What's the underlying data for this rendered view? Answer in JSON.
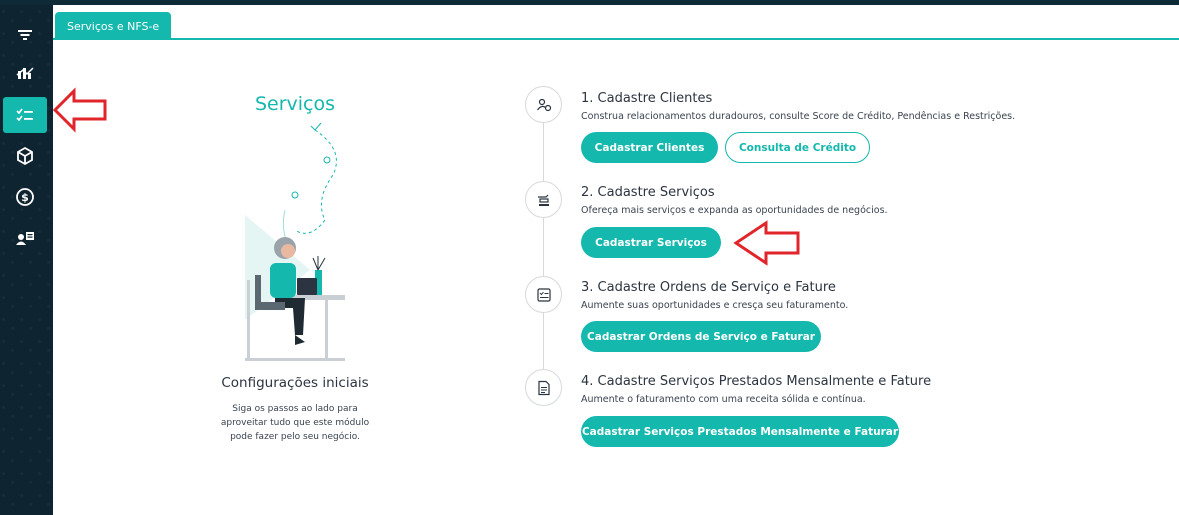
{
  "tab": {
    "label": "Serviços e NFS-e"
  },
  "sidebar": {
    "items": [
      {
        "icon": "filter-icon"
      },
      {
        "icon": "chart-icon"
      },
      {
        "icon": "checklist-icon",
        "active": true
      },
      {
        "icon": "box-icon"
      },
      {
        "icon": "dollar-icon"
      },
      {
        "icon": "user-card-icon"
      }
    ]
  },
  "left": {
    "title": "Serviços",
    "config_title": "Configurações iniciais",
    "config_desc": "Siga os passos ao lado para aproveitar tudo que este módulo pode fazer pelo seu negócio."
  },
  "steps": [
    {
      "title": "1. Cadastre Clientes",
      "desc": "Construa relacionamentos duradouros, consulte Score de Crédito, Pendências e Restrições.",
      "icon": "users-gear-icon",
      "buttons": [
        "Cadastrar Clientes",
        "Consulta de Crédito"
      ]
    },
    {
      "title": "2. Cadastre Serviços",
      "desc": "Ofereça mais serviços e expanda as oportunidades de negócios.",
      "icon": "service-hand-icon",
      "buttons": [
        "Cadastrar Serviços"
      ]
    },
    {
      "title": "3. Cadastre Ordens de Serviço e Fature",
      "desc": "Aumente suas oportunidades e cresça seu faturamento.",
      "icon": "checklist-board-icon",
      "buttons": [
        "Cadastrar Ordens de Serviço e Faturar"
      ]
    },
    {
      "title": "4. Cadastre Serviços Prestados Mensalmente e Fature",
      "desc": "Aumente o faturamento com uma receita sólida e contínua.",
      "icon": "document-icon",
      "buttons": [
        "Cadastrar Serviços Prestados Mensalmente e Faturar"
      ]
    }
  ],
  "colors": {
    "accent": "#14b8ad",
    "sidebar": "#0f2431",
    "annotation": "#e0262b"
  }
}
